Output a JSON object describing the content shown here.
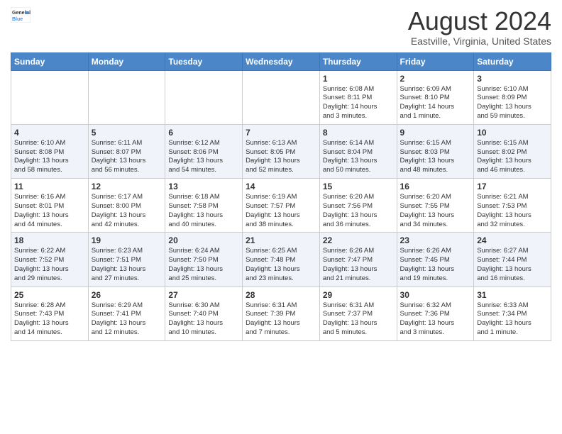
{
  "logo": {
    "general": "General",
    "blue": "Blue"
  },
  "header": {
    "title": "August 2024",
    "subtitle": "Eastville, Virginia, United States"
  },
  "weekdays": [
    "Sunday",
    "Monday",
    "Tuesday",
    "Wednesday",
    "Thursday",
    "Friday",
    "Saturday"
  ],
  "weeks": [
    [
      {
        "day": "",
        "info": ""
      },
      {
        "day": "",
        "info": ""
      },
      {
        "day": "",
        "info": ""
      },
      {
        "day": "",
        "info": ""
      },
      {
        "day": "1",
        "info": "Sunrise: 6:08 AM\nSunset: 8:11 PM\nDaylight: 14 hours\nand 3 minutes."
      },
      {
        "day": "2",
        "info": "Sunrise: 6:09 AM\nSunset: 8:10 PM\nDaylight: 14 hours\nand 1 minute."
      },
      {
        "day": "3",
        "info": "Sunrise: 6:10 AM\nSunset: 8:09 PM\nDaylight: 13 hours\nand 59 minutes."
      }
    ],
    [
      {
        "day": "4",
        "info": "Sunrise: 6:10 AM\nSunset: 8:08 PM\nDaylight: 13 hours\nand 58 minutes."
      },
      {
        "day": "5",
        "info": "Sunrise: 6:11 AM\nSunset: 8:07 PM\nDaylight: 13 hours\nand 56 minutes."
      },
      {
        "day": "6",
        "info": "Sunrise: 6:12 AM\nSunset: 8:06 PM\nDaylight: 13 hours\nand 54 minutes."
      },
      {
        "day": "7",
        "info": "Sunrise: 6:13 AM\nSunset: 8:05 PM\nDaylight: 13 hours\nand 52 minutes."
      },
      {
        "day": "8",
        "info": "Sunrise: 6:14 AM\nSunset: 8:04 PM\nDaylight: 13 hours\nand 50 minutes."
      },
      {
        "day": "9",
        "info": "Sunrise: 6:15 AM\nSunset: 8:03 PM\nDaylight: 13 hours\nand 48 minutes."
      },
      {
        "day": "10",
        "info": "Sunrise: 6:15 AM\nSunset: 8:02 PM\nDaylight: 13 hours\nand 46 minutes."
      }
    ],
    [
      {
        "day": "11",
        "info": "Sunrise: 6:16 AM\nSunset: 8:01 PM\nDaylight: 13 hours\nand 44 minutes."
      },
      {
        "day": "12",
        "info": "Sunrise: 6:17 AM\nSunset: 8:00 PM\nDaylight: 13 hours\nand 42 minutes."
      },
      {
        "day": "13",
        "info": "Sunrise: 6:18 AM\nSunset: 7:58 PM\nDaylight: 13 hours\nand 40 minutes."
      },
      {
        "day": "14",
        "info": "Sunrise: 6:19 AM\nSunset: 7:57 PM\nDaylight: 13 hours\nand 38 minutes."
      },
      {
        "day": "15",
        "info": "Sunrise: 6:20 AM\nSunset: 7:56 PM\nDaylight: 13 hours\nand 36 minutes."
      },
      {
        "day": "16",
        "info": "Sunrise: 6:20 AM\nSunset: 7:55 PM\nDaylight: 13 hours\nand 34 minutes."
      },
      {
        "day": "17",
        "info": "Sunrise: 6:21 AM\nSunset: 7:53 PM\nDaylight: 13 hours\nand 32 minutes."
      }
    ],
    [
      {
        "day": "18",
        "info": "Sunrise: 6:22 AM\nSunset: 7:52 PM\nDaylight: 13 hours\nand 29 minutes."
      },
      {
        "day": "19",
        "info": "Sunrise: 6:23 AM\nSunset: 7:51 PM\nDaylight: 13 hours\nand 27 minutes."
      },
      {
        "day": "20",
        "info": "Sunrise: 6:24 AM\nSunset: 7:50 PM\nDaylight: 13 hours\nand 25 minutes."
      },
      {
        "day": "21",
        "info": "Sunrise: 6:25 AM\nSunset: 7:48 PM\nDaylight: 13 hours\nand 23 minutes."
      },
      {
        "day": "22",
        "info": "Sunrise: 6:26 AM\nSunset: 7:47 PM\nDaylight: 13 hours\nand 21 minutes."
      },
      {
        "day": "23",
        "info": "Sunrise: 6:26 AM\nSunset: 7:45 PM\nDaylight: 13 hours\nand 19 minutes."
      },
      {
        "day": "24",
        "info": "Sunrise: 6:27 AM\nSunset: 7:44 PM\nDaylight: 13 hours\nand 16 minutes."
      }
    ],
    [
      {
        "day": "25",
        "info": "Sunrise: 6:28 AM\nSunset: 7:43 PM\nDaylight: 13 hours\nand 14 minutes."
      },
      {
        "day": "26",
        "info": "Sunrise: 6:29 AM\nSunset: 7:41 PM\nDaylight: 13 hours\nand 12 minutes."
      },
      {
        "day": "27",
        "info": "Sunrise: 6:30 AM\nSunset: 7:40 PM\nDaylight: 13 hours\nand 10 minutes."
      },
      {
        "day": "28",
        "info": "Sunrise: 6:31 AM\nSunset: 7:39 PM\nDaylight: 13 hours\nand 7 minutes."
      },
      {
        "day": "29",
        "info": "Sunrise: 6:31 AM\nSunset: 7:37 PM\nDaylight: 13 hours\nand 5 minutes."
      },
      {
        "day": "30",
        "info": "Sunrise: 6:32 AM\nSunset: 7:36 PM\nDaylight: 13 hours\nand 3 minutes."
      },
      {
        "day": "31",
        "info": "Sunrise: 6:33 AM\nSunset: 7:34 PM\nDaylight: 13 hours\nand 1 minute."
      }
    ]
  ]
}
